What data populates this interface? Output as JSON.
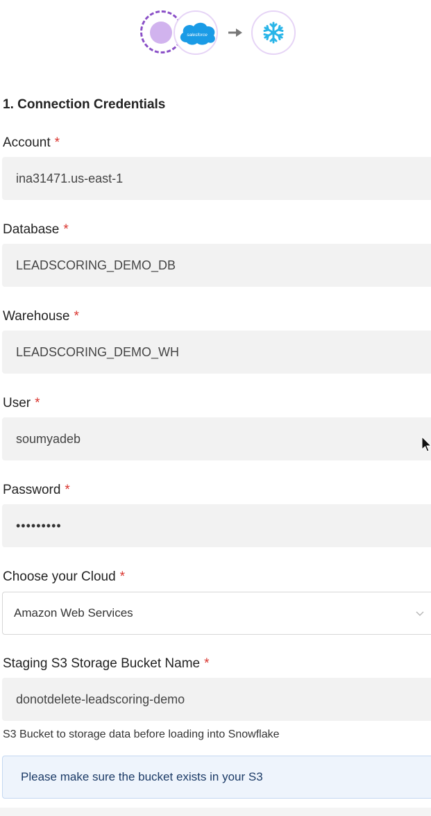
{
  "header": {
    "source_label": "salesforce",
    "icons": [
      "source-placeholder-icon",
      "salesforce-icon",
      "arrow-right-icon",
      "snowflake-icon"
    ],
    "colors": {
      "dashed_ring": "#8a4fc7",
      "source_fill": "#d1b3ee",
      "salesforce_blue": "#1a9be6",
      "snowflake_blue": "#29b5e8",
      "arrow_gray": "#777777"
    }
  },
  "section": {
    "title": "1. Connection Credentials"
  },
  "form": {
    "required_marker": "*",
    "account": {
      "label": "Account",
      "value": "ina31471.us-east-1"
    },
    "database": {
      "label": "Database",
      "value": "LEADSCORING_DEMO_DB"
    },
    "warehouse": {
      "label": "Warehouse",
      "value": "LEADSCORING_DEMO_WH"
    },
    "user": {
      "label": "User",
      "value": "soumyadeb"
    },
    "password": {
      "label": "Password",
      "value": "•••••••••"
    },
    "cloud": {
      "label": "Choose your Cloud",
      "value": "Amazon Web Services"
    },
    "bucket": {
      "label": "Staging S3 Storage Bucket Name",
      "value": "donotdelete-leadscoring-demo",
      "help": "S3 Bucket to storage data before loading into Snowflake"
    },
    "notice": "Please make sure the bucket exists in your S3"
  },
  "colors": {
    "required": "#d9332d",
    "field_bg": "#f2f2f2",
    "notice_bg": "#eef4fc",
    "notice_border": "#c4d8f2"
  }
}
